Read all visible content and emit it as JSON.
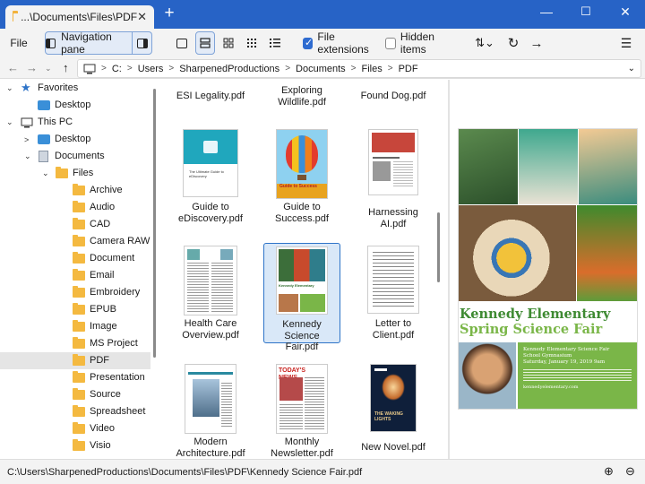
{
  "tab": {
    "title": "...\\Documents\\Files\\PDF"
  },
  "toolbar": {
    "file_label": "File",
    "nav_pane_label": "Navigation pane",
    "file_ext_label": "File extensions",
    "hidden_items_label": "Hidden items"
  },
  "breadcrumb": {
    "segments": [
      "C:",
      "Users",
      "SharpenedProductions",
      "Documents",
      "Files",
      "PDF"
    ]
  },
  "tree": {
    "favorites": "Favorites",
    "fav_desktop": "Desktop",
    "this_pc": "This PC",
    "desktop": "Desktop",
    "documents": "Documents",
    "files": "Files",
    "folders": [
      "Archive",
      "Audio",
      "CAD",
      "Camera RAW",
      "Document",
      "Email",
      "Embroidery",
      "EPUB",
      "Image",
      "MS Project",
      "PDF",
      "Presentation",
      "Source",
      "Spreadsheet",
      "Video",
      "Visio"
    ]
  },
  "files": {
    "row0": [
      "ESI Legality.pdf",
      "Exploring\nWildlife.pdf",
      "Found Dog.pdf"
    ],
    "row1": [
      "Guide to\neDiscovery.pdf",
      "Guide to\nSuccess.pdf",
      "Harnessing AI.pdf"
    ],
    "row2": [
      "Health Care\nOverview.pdf",
      "Kennedy Science\nFair.pdf",
      "Letter to\nClient.pdf"
    ],
    "row3": [
      "Modern\nArchitecture.pdf",
      "Monthly\nNewsletter.pdf",
      "New Novel.pdf"
    ]
  },
  "preview": {
    "title1": "Kennedy Elementary",
    "title2": "Spring Science Fair",
    "box_title": "Kennedy Elementary Science Fair\nSchool Gymnasium\nSaturday, January 19, 2019 9am",
    "url": "kennedyelementary.com",
    "thumb_titles": {
      "guide": "The Ultimate Guide to eDiscovery",
      "success": "Guide to Success",
      "kennedy": "Kennedy Elementary",
      "news": "TODAY'S NEWS",
      "novel": "THE WAKING LIGHTS"
    }
  },
  "status": {
    "path": "C:\\Users\\SharpenedProductions\\Documents\\Files\\PDF\\Kennedy Science Fair.pdf"
  },
  "colors": {
    "titlebar": "#2763c6",
    "accent": "#2e74c8",
    "folder": "#f4b940",
    "preview_green": "#3e8a32",
    "preview_box": "#7ab648"
  }
}
